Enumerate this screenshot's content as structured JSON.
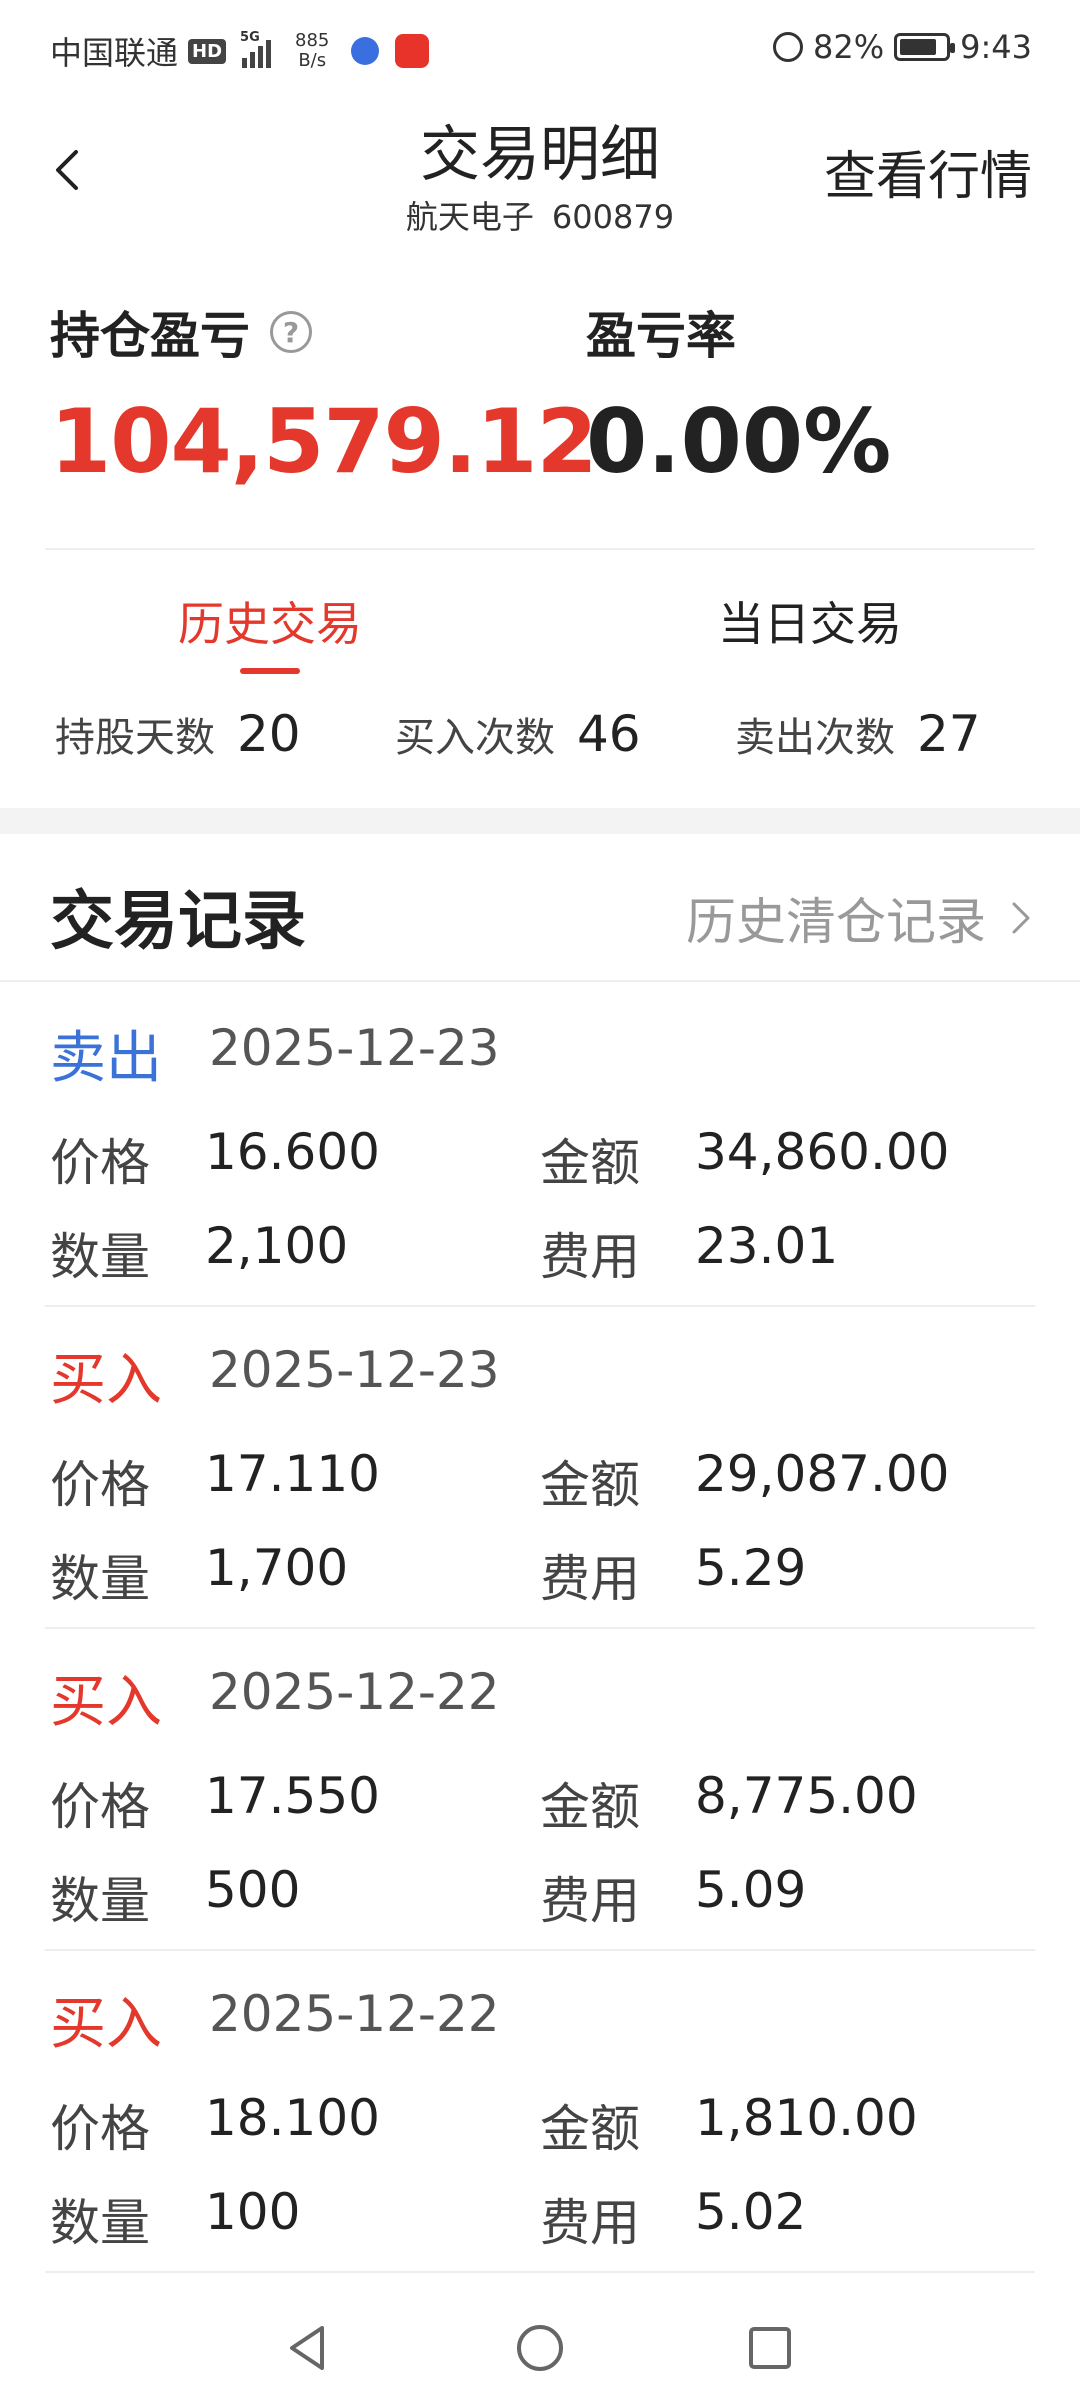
{
  "status_bar": {
    "carrier": "中国联通",
    "hd_label": "HD",
    "network": "5G",
    "speed_value": "885",
    "speed_unit": "B/s",
    "battery": "82%",
    "battery_level": 0.82,
    "time": "9:43"
  },
  "header": {
    "title": "交易明细",
    "stock_name": "航天电子",
    "stock_code": "600879",
    "quote_link": "查看行情"
  },
  "summary": {
    "pnl_label": "持仓盈亏",
    "pnl_value": "104,579.12",
    "rate_label": "盈亏率",
    "rate_value": "0.00%",
    "help_icon": "question-circle-icon"
  },
  "tabs": [
    {
      "label": "历史交易",
      "active": true
    },
    {
      "label": "当日交易",
      "active": false
    }
  ],
  "stats": [
    {
      "label": "持股天数",
      "value": "20"
    },
    {
      "label": "买入次数",
      "value": "46"
    },
    {
      "label": "卖出次数",
      "value": "27"
    }
  ],
  "records_section": {
    "title": "交易记录",
    "history_link": "历史清仓记录"
  },
  "field_labels": {
    "price": "价格",
    "amount": "金额",
    "quantity": "数量",
    "fee": "费用"
  },
  "records": [
    {
      "type": "卖出",
      "date": "2025-12-23",
      "price": "16.600",
      "amount": "34,860.00",
      "quantity": "2,100",
      "fee": "23.01"
    },
    {
      "type": "买入",
      "date": "2025-12-23",
      "price": "17.110",
      "amount": "29,087.00",
      "quantity": "1,700",
      "fee": "5.29"
    },
    {
      "type": "买入",
      "date": "2025-12-22",
      "price": "17.550",
      "amount": "8,775.00",
      "quantity": "500",
      "fee": "5.09"
    },
    {
      "type": "买入",
      "date": "2025-12-22",
      "price": "18.100",
      "amount": "1,810.00",
      "quantity": "100",
      "fee": "5.02"
    }
  ],
  "colors": {
    "profit_red": "#e3382b",
    "sell_blue": "#3a72d8",
    "muted_gray": "#999999"
  }
}
